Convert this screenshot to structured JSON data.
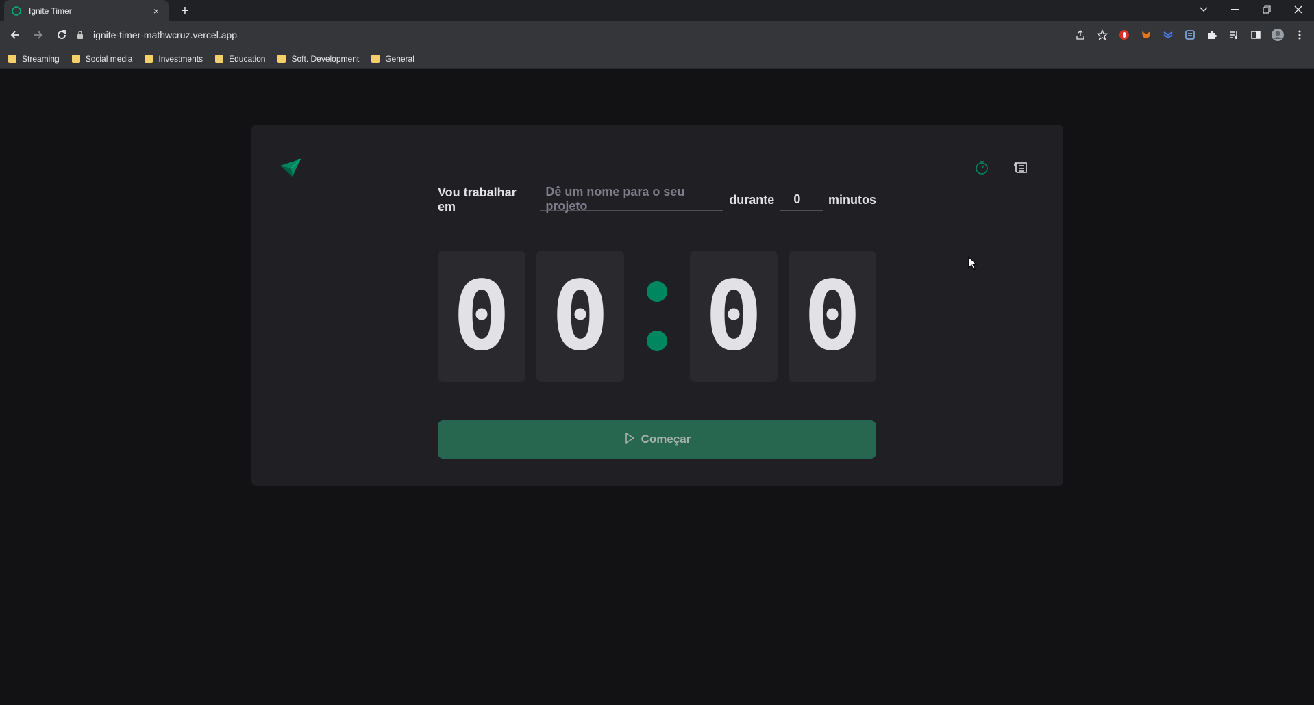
{
  "browser": {
    "tab_title": "Ignite Timer",
    "tab_close": "×",
    "new_tab": "+",
    "url": "ignite-timer-mathwcruz.vercel.app",
    "bookmarks": [
      "Streaming",
      "Social media",
      "Investments",
      "Education",
      "Soft. Development",
      "General"
    ]
  },
  "app": {
    "form": {
      "label_task": "Vou trabalhar em",
      "task_placeholder": "Dê um nome para o seu projeto",
      "label_during": "durante",
      "minutes_value": "0",
      "label_minutes": "minutos"
    },
    "countdown": {
      "minutes_tens": "0",
      "minutes_ones": "0",
      "seconds_tens": "0",
      "seconds_ones": "0"
    },
    "start_button": "Começar",
    "colors": {
      "accent": "#00875f",
      "button_bg": "#27664f",
      "card_bg": "#202024",
      "page_bg": "#121214"
    },
    "icons": [
      "logo-icon",
      "timer-icon",
      "history-icon",
      "play-icon"
    ]
  }
}
